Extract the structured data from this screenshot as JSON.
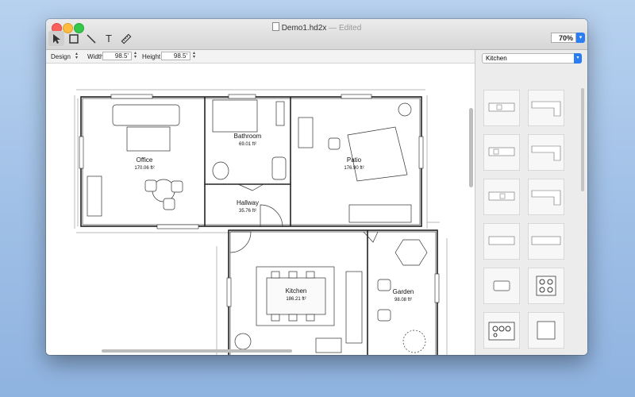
{
  "window": {
    "title": "Demo1.hd2x",
    "edited": "— Edited"
  },
  "toolbar": {
    "tools": [
      {
        "name": "select-tool",
        "icon": "arrow-pointer-icon"
      },
      {
        "name": "rectangle-tool",
        "icon": "rectangle-icon"
      },
      {
        "name": "line-tool",
        "icon": "line-icon"
      },
      {
        "name": "text-tool",
        "icon": "text-icon",
        "glyph": "T"
      },
      {
        "name": "ruler-tool",
        "icon": "ruler-icon"
      }
    ],
    "zoom": "70%"
  },
  "properties": {
    "mode": "Design",
    "width_label": "Width",
    "width_value": "98.5'",
    "height_label": "Height",
    "height_value": "98.5'"
  },
  "rooms": [
    {
      "name": "Office",
      "area": "170.06 ft²"
    },
    {
      "name": "Bathroom",
      "area": "69.01 ft²"
    },
    {
      "name": "Patio",
      "area": "176.90 ft²"
    },
    {
      "name": "Hallway",
      "area": "35.76 ft²"
    },
    {
      "name": "Kitchen",
      "area": "186.21 ft²"
    },
    {
      "name": "Garden",
      "area": "98.08 ft²"
    }
  ],
  "library": {
    "category": "Kitchen"
  },
  "colors": {
    "accent": "#2b7df2",
    "wall": "#222222"
  }
}
